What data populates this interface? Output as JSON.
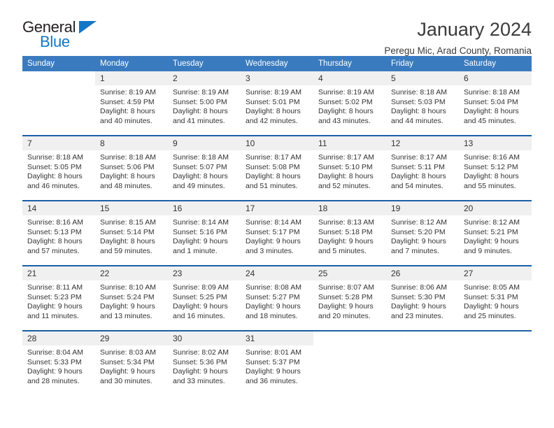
{
  "brand": {
    "name_part1": "General",
    "name_part2": "Blue",
    "accent_color": "#1277c6"
  },
  "header": {
    "title": "January 2024",
    "subtitle": "Peregu Mic, Arad County, Romania"
  },
  "theme": {
    "header_bg": "#3a7bbf",
    "week_divider": "#1a5fa8",
    "daynum_bg": "#f0f0f0"
  },
  "weekday_headers": [
    "Sunday",
    "Monday",
    "Tuesday",
    "Wednesday",
    "Thursday",
    "Friday",
    "Saturday"
  ],
  "weeks": [
    {
      "days": [
        {
          "num": "",
          "l1": "",
          "l2": "",
          "l3": "",
          "l4": ""
        },
        {
          "num": "1",
          "l1": "Sunrise: 8:19 AM",
          "l2": "Sunset: 4:59 PM",
          "l3": "Daylight: 8 hours",
          "l4": "and 40 minutes."
        },
        {
          "num": "2",
          "l1": "Sunrise: 8:19 AM",
          "l2": "Sunset: 5:00 PM",
          "l3": "Daylight: 8 hours",
          "l4": "and 41 minutes."
        },
        {
          "num": "3",
          "l1": "Sunrise: 8:19 AM",
          "l2": "Sunset: 5:01 PM",
          "l3": "Daylight: 8 hours",
          "l4": "and 42 minutes."
        },
        {
          "num": "4",
          "l1": "Sunrise: 8:19 AM",
          "l2": "Sunset: 5:02 PM",
          "l3": "Daylight: 8 hours",
          "l4": "and 43 minutes."
        },
        {
          "num": "5",
          "l1": "Sunrise: 8:18 AM",
          "l2": "Sunset: 5:03 PM",
          "l3": "Daylight: 8 hours",
          "l4": "and 44 minutes."
        },
        {
          "num": "6",
          "l1": "Sunrise: 8:18 AM",
          "l2": "Sunset: 5:04 PM",
          "l3": "Daylight: 8 hours",
          "l4": "and 45 minutes."
        }
      ]
    },
    {
      "days": [
        {
          "num": "7",
          "l1": "Sunrise: 8:18 AM",
          "l2": "Sunset: 5:05 PM",
          "l3": "Daylight: 8 hours",
          "l4": "and 46 minutes."
        },
        {
          "num": "8",
          "l1": "Sunrise: 8:18 AM",
          "l2": "Sunset: 5:06 PM",
          "l3": "Daylight: 8 hours",
          "l4": "and 48 minutes."
        },
        {
          "num": "9",
          "l1": "Sunrise: 8:18 AM",
          "l2": "Sunset: 5:07 PM",
          "l3": "Daylight: 8 hours",
          "l4": "and 49 minutes."
        },
        {
          "num": "10",
          "l1": "Sunrise: 8:17 AM",
          "l2": "Sunset: 5:08 PM",
          "l3": "Daylight: 8 hours",
          "l4": "and 51 minutes."
        },
        {
          "num": "11",
          "l1": "Sunrise: 8:17 AM",
          "l2": "Sunset: 5:10 PM",
          "l3": "Daylight: 8 hours",
          "l4": "and 52 minutes."
        },
        {
          "num": "12",
          "l1": "Sunrise: 8:17 AM",
          "l2": "Sunset: 5:11 PM",
          "l3": "Daylight: 8 hours",
          "l4": "and 54 minutes."
        },
        {
          "num": "13",
          "l1": "Sunrise: 8:16 AM",
          "l2": "Sunset: 5:12 PM",
          "l3": "Daylight: 8 hours",
          "l4": "and 55 minutes."
        }
      ]
    },
    {
      "days": [
        {
          "num": "14",
          "l1": "Sunrise: 8:16 AM",
          "l2": "Sunset: 5:13 PM",
          "l3": "Daylight: 8 hours",
          "l4": "and 57 minutes."
        },
        {
          "num": "15",
          "l1": "Sunrise: 8:15 AM",
          "l2": "Sunset: 5:14 PM",
          "l3": "Daylight: 8 hours",
          "l4": "and 59 minutes."
        },
        {
          "num": "16",
          "l1": "Sunrise: 8:14 AM",
          "l2": "Sunset: 5:16 PM",
          "l3": "Daylight: 9 hours",
          "l4": "and 1 minute."
        },
        {
          "num": "17",
          "l1": "Sunrise: 8:14 AM",
          "l2": "Sunset: 5:17 PM",
          "l3": "Daylight: 9 hours",
          "l4": "and 3 minutes."
        },
        {
          "num": "18",
          "l1": "Sunrise: 8:13 AM",
          "l2": "Sunset: 5:18 PM",
          "l3": "Daylight: 9 hours",
          "l4": "and 5 minutes."
        },
        {
          "num": "19",
          "l1": "Sunrise: 8:12 AM",
          "l2": "Sunset: 5:20 PM",
          "l3": "Daylight: 9 hours",
          "l4": "and 7 minutes."
        },
        {
          "num": "20",
          "l1": "Sunrise: 8:12 AM",
          "l2": "Sunset: 5:21 PM",
          "l3": "Daylight: 9 hours",
          "l4": "and 9 minutes."
        }
      ]
    },
    {
      "days": [
        {
          "num": "21",
          "l1": "Sunrise: 8:11 AM",
          "l2": "Sunset: 5:23 PM",
          "l3": "Daylight: 9 hours",
          "l4": "and 11 minutes."
        },
        {
          "num": "22",
          "l1": "Sunrise: 8:10 AM",
          "l2": "Sunset: 5:24 PM",
          "l3": "Daylight: 9 hours",
          "l4": "and 13 minutes."
        },
        {
          "num": "23",
          "l1": "Sunrise: 8:09 AM",
          "l2": "Sunset: 5:25 PM",
          "l3": "Daylight: 9 hours",
          "l4": "and 16 minutes."
        },
        {
          "num": "24",
          "l1": "Sunrise: 8:08 AM",
          "l2": "Sunset: 5:27 PM",
          "l3": "Daylight: 9 hours",
          "l4": "and 18 minutes."
        },
        {
          "num": "25",
          "l1": "Sunrise: 8:07 AM",
          "l2": "Sunset: 5:28 PM",
          "l3": "Daylight: 9 hours",
          "l4": "and 20 minutes."
        },
        {
          "num": "26",
          "l1": "Sunrise: 8:06 AM",
          "l2": "Sunset: 5:30 PM",
          "l3": "Daylight: 9 hours",
          "l4": "and 23 minutes."
        },
        {
          "num": "27",
          "l1": "Sunrise: 8:05 AM",
          "l2": "Sunset: 5:31 PM",
          "l3": "Daylight: 9 hours",
          "l4": "and 25 minutes."
        }
      ]
    },
    {
      "days": [
        {
          "num": "28",
          "l1": "Sunrise: 8:04 AM",
          "l2": "Sunset: 5:33 PM",
          "l3": "Daylight: 9 hours",
          "l4": "and 28 minutes."
        },
        {
          "num": "29",
          "l1": "Sunrise: 8:03 AM",
          "l2": "Sunset: 5:34 PM",
          "l3": "Daylight: 9 hours",
          "l4": "and 30 minutes."
        },
        {
          "num": "30",
          "l1": "Sunrise: 8:02 AM",
          "l2": "Sunset: 5:36 PM",
          "l3": "Daylight: 9 hours",
          "l4": "and 33 minutes."
        },
        {
          "num": "31",
          "l1": "Sunrise: 8:01 AM",
          "l2": "Sunset: 5:37 PM",
          "l3": "Daylight: 9 hours",
          "l4": "and 36 minutes."
        },
        {
          "num": "",
          "l1": "",
          "l2": "",
          "l3": "",
          "l4": ""
        },
        {
          "num": "",
          "l1": "",
          "l2": "",
          "l3": "",
          "l4": ""
        },
        {
          "num": "",
          "l1": "",
          "l2": "",
          "l3": "",
          "l4": ""
        }
      ]
    }
  ]
}
